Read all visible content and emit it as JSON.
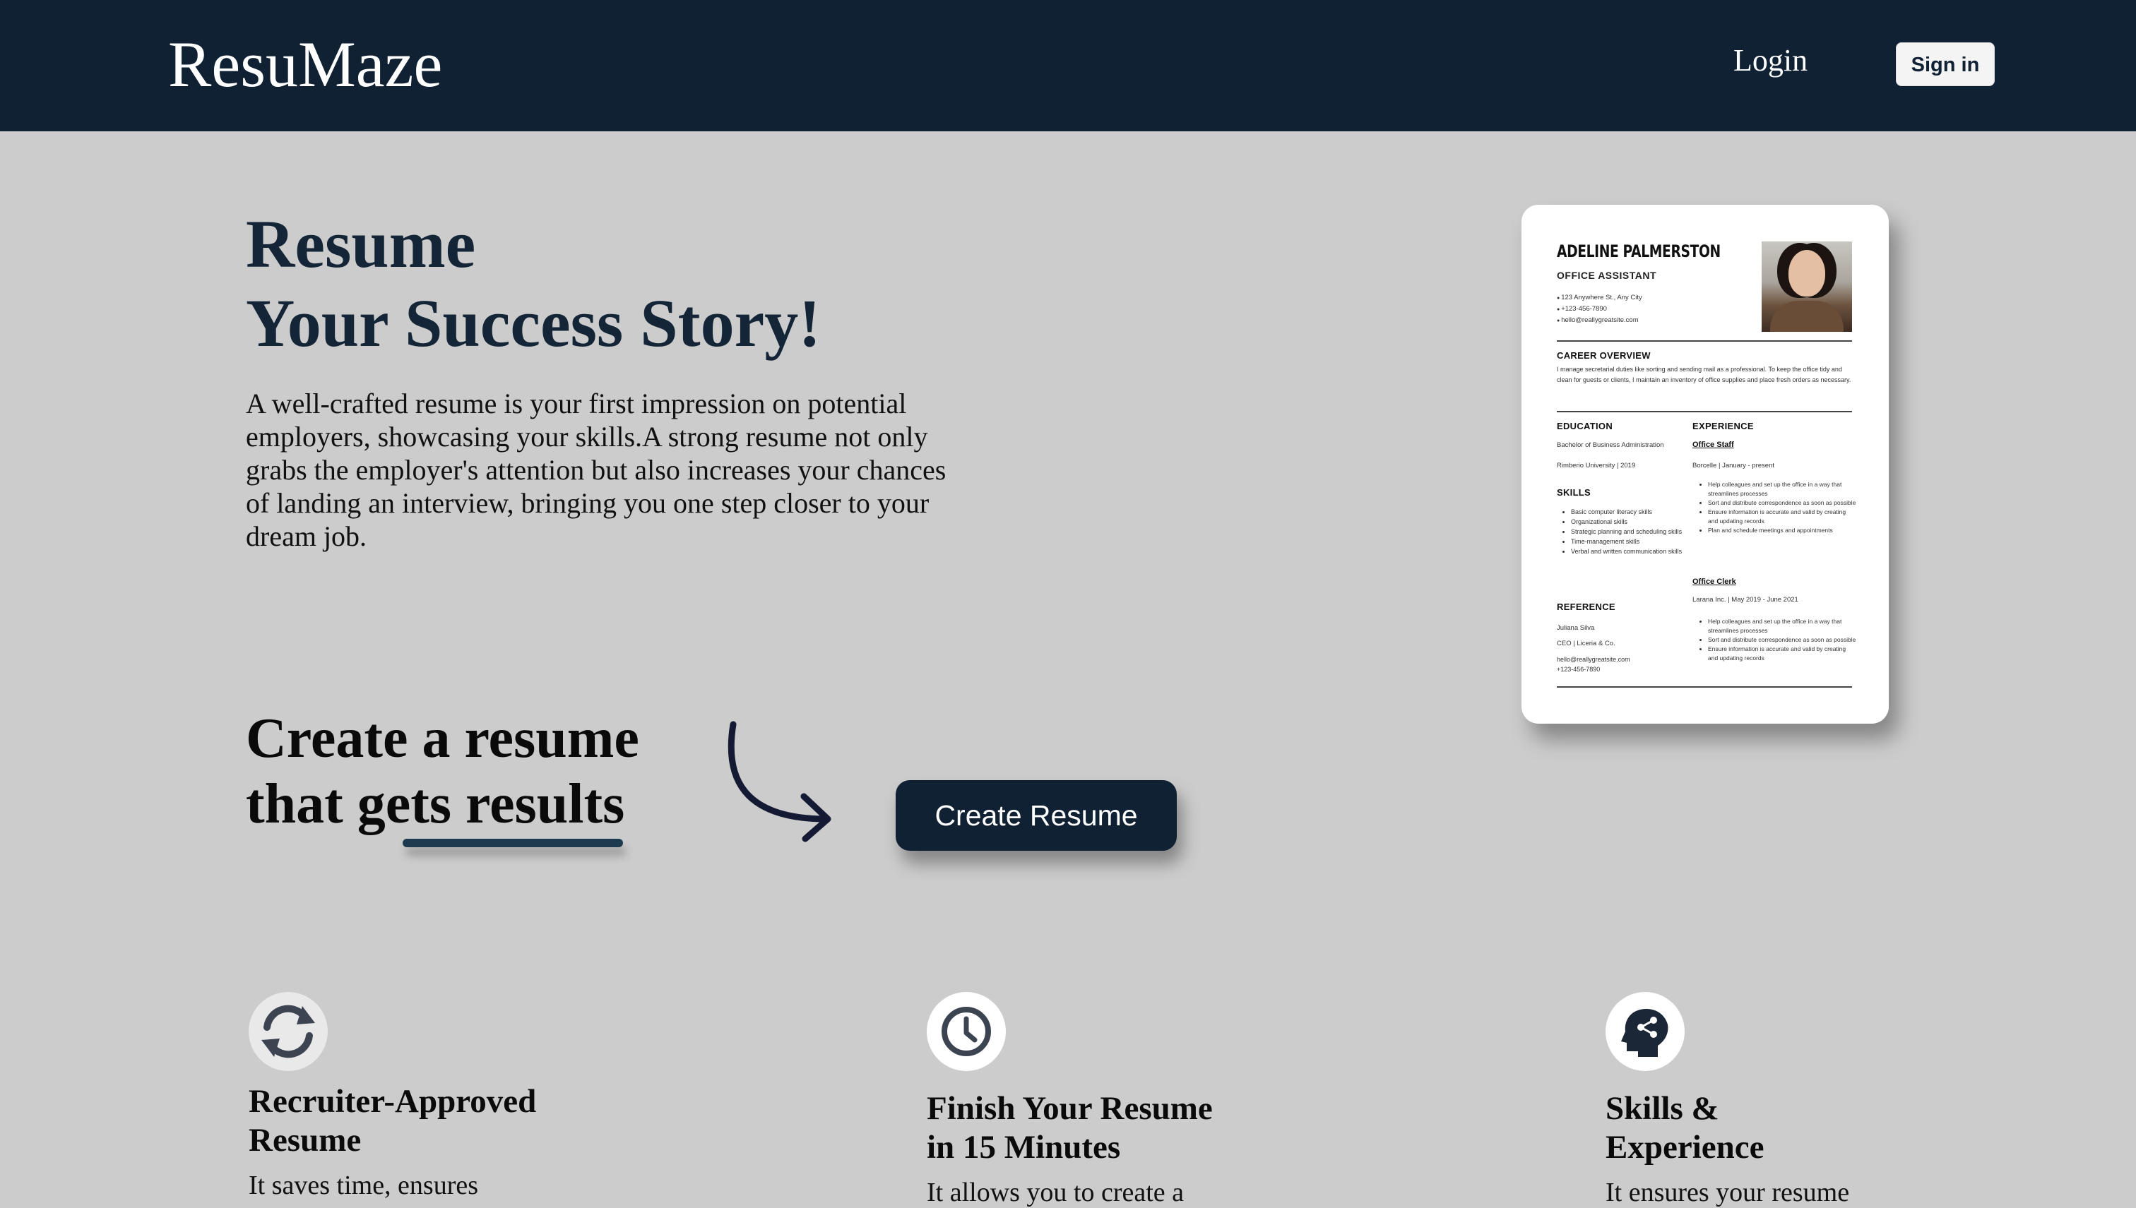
{
  "header": {
    "logo": "ResuMaze",
    "login_label": "Login",
    "signin_label": "Sign in"
  },
  "hero": {
    "title_line1": "Resume",
    "title_line2": "Your Success Story!",
    "description": "A well-crafted resume is your first impression on potential employers, showcasing your skills.A strong resume not only grabs the employer's attention but also increases your chances of landing an interview, bringing you one step closer to your dream job."
  },
  "cta": {
    "line1": "Create a resume",
    "line2": "that gets results",
    "button_label": "Create Resume"
  },
  "resume_preview": {
    "name": "ADELINE PALMERSTON",
    "role": "OFFICE ASSISTANT",
    "address": "123 Anywhere St., Any City",
    "phone": "+123-456-7890",
    "email": "hello@reallygreatsite.com",
    "career_heading": "CAREER OVERVIEW",
    "career_text": "I manage secretarial duties like sorting and sending mail as a professional. To keep the office tidy and clean for guests or clients, I maintain an inventory of office supplies and place fresh orders as necessary.",
    "education_heading": "EDUCATION",
    "education_degree": "Bachelor of Business Administration",
    "education_school": "Rimberio University | 2019",
    "skills_heading": "SKILLS",
    "skills": [
      "Basic computer literacy skills",
      "Organizational skills",
      "Strategic planning and scheduling skills",
      "Time-management skills",
      "Verbal and written communication skills"
    ],
    "reference_heading": "REFERENCE",
    "reference_name": "Juliana Silva",
    "reference_title": "CEO | Liceria & Co.",
    "reference_email": "hello@reallygreatsite.com",
    "reference_phone": "+123-456-7890",
    "experience_heading": "EXPERIENCE",
    "job1_title": "Office Staff",
    "job1_meta": "Borcelle | January - present",
    "job1_items": [
      "Help colleagues and set up the office in a way that streamlines processes",
      "Sort and distribute correspondence as soon as possible",
      "Ensure information is accurate and valid by creating and updating records",
      "Plan and schedule meetings and appointments"
    ],
    "job2_title": "Office Clerk",
    "job2_meta": "Larana Inc. | May 2019 - June 2021",
    "job2_items": [
      "Help colleagues and set up the office in a way that streamlines processes",
      "Sort and distribute correspondence as soon as possible",
      "Ensure information is accurate and valid by creating and updating records"
    ]
  },
  "features": [
    {
      "icon": "refresh-icon",
      "title_line1": "Recruiter-Approved",
      "title_line2": "Resume",
      "text": "It saves time, ensures"
    },
    {
      "icon": "clock-icon",
      "title_line1": "Finish Your Resume",
      "title_line2": "in 15 Minutes",
      "text": "It allows you to create a"
    },
    {
      "icon": "head-share-icon",
      "title_line1": "Skills &",
      "title_line2": "Experience",
      "text": "It ensures your resume"
    }
  ],
  "colors": {
    "navy": "#0f2133",
    "background": "#cccccc",
    "heading": "#132536"
  }
}
